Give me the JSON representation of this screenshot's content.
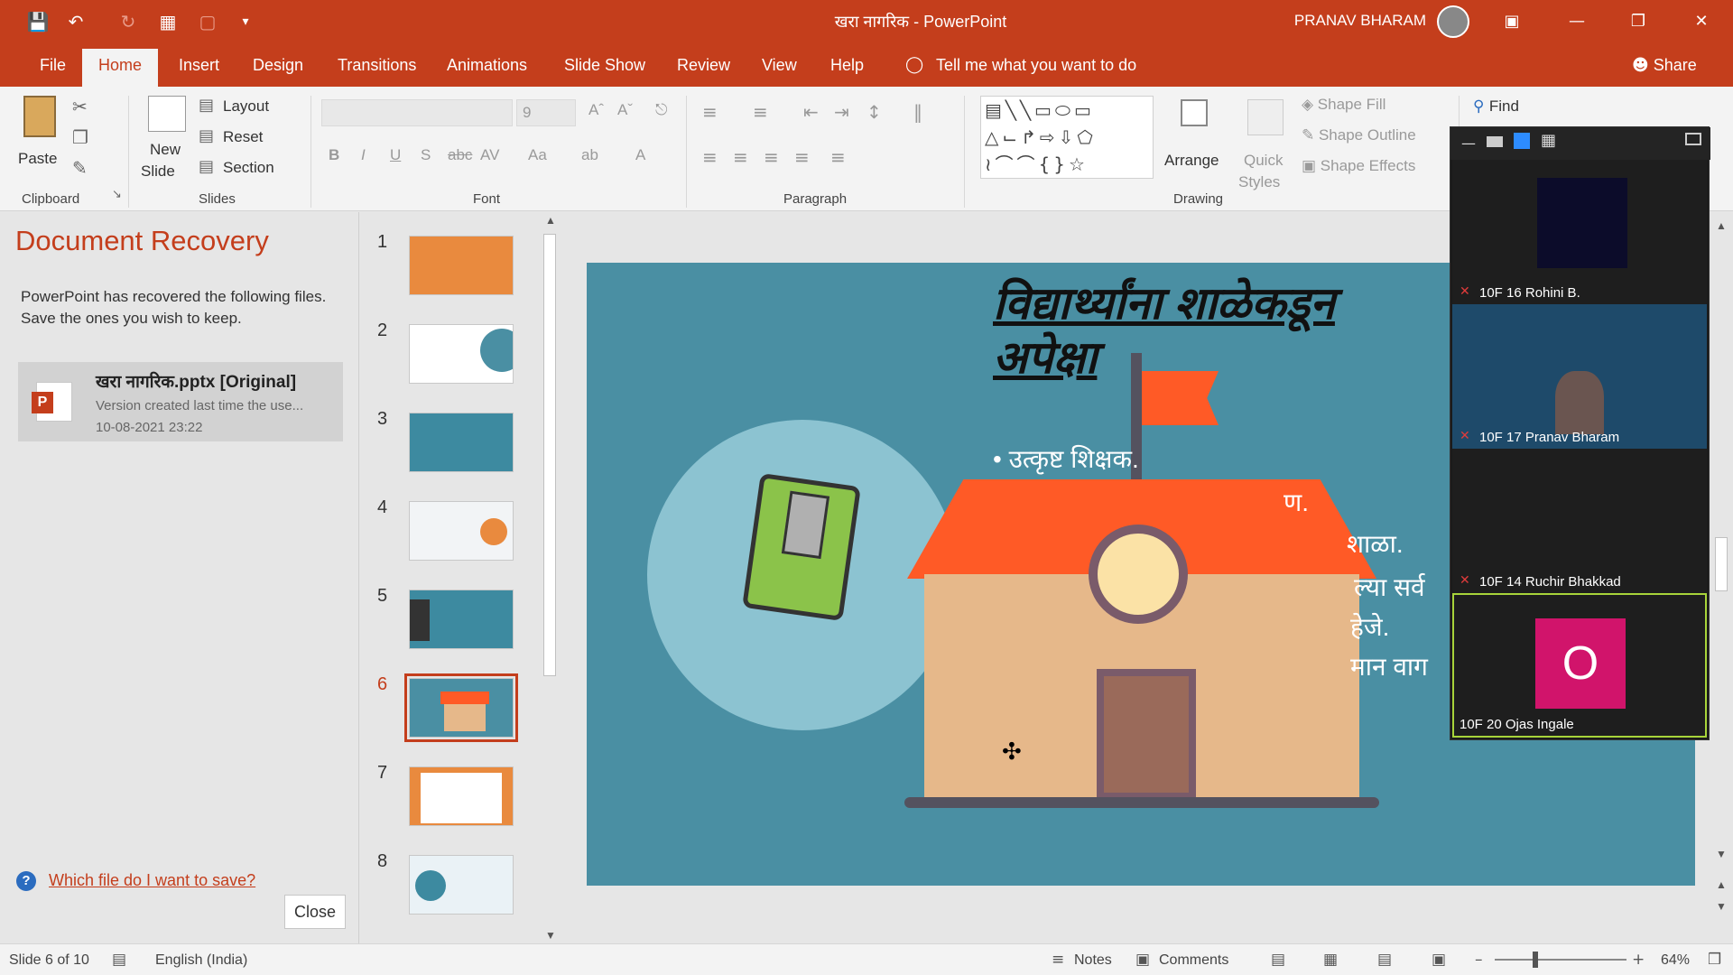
{
  "titlebar": {
    "document_title": "खरा नागरिक",
    "separator": "-",
    "app_name": "PowerPoint",
    "user_name": "PRANAV BHARAM"
  },
  "tabs": [
    "File",
    "Home",
    "Insert",
    "Design",
    "Transitions",
    "Animations",
    "Slide Show",
    "Review",
    "View",
    "Help"
  ],
  "tell_me": "Tell me what you want to do",
  "share": "Share",
  "ribbon": {
    "clipboard": {
      "label": "Clipboard",
      "paste": "Paste"
    },
    "slides": {
      "label": "Slides",
      "new_slide_1": "New",
      "new_slide_2": "Slide",
      "layout": "Layout",
      "reset": "Reset",
      "section": "Section"
    },
    "font": {
      "label": "Font",
      "size": "9"
    },
    "paragraph": {
      "label": "Paragraph"
    },
    "drawing": {
      "label": "Drawing",
      "arrange": "Arrange",
      "quick_1": "Quick",
      "quick_2": "Styles",
      "shape_fill": "Shape Fill",
      "shape_outline": "Shape Outline",
      "shape_effects": "Shape Effects"
    },
    "editing": {
      "find": "Find"
    }
  },
  "recovery": {
    "title": "Document Recovery",
    "description": "PowerPoint has recovered the following files. Save the ones you wish to keep.",
    "file_name": "खरा नागरिक.pptx  [Original]",
    "file_desc": "Version created last time the use...",
    "file_date": "10-08-2021 23:22",
    "help_link": "Which file do I want to save?",
    "close": "Close"
  },
  "thumbnails": [
    "1",
    "2",
    "3",
    "4",
    "5",
    "6",
    "7",
    "8"
  ],
  "selected_slide": 6,
  "slide": {
    "title_line1": "विद्यार्थ्यांना शाळेकडून",
    "title_line2": "अपेक्षा",
    "bullet_1": "• उत्कृष्ट शिक्षक.",
    "bullet_2": "ण.",
    "bullet_3": "शाळा.",
    "bullet_4": "ल्या सर्व",
    "bullet_5": "हेजे.",
    "bullet_6": "मान वाग"
  },
  "zoom": {
    "participants": [
      {
        "name": "10F 16 Rohini B."
      },
      {
        "name": "10F 17 Pranav Bharam"
      },
      {
        "name": "10F 14 Ruchir Bhakkad"
      },
      {
        "name": "10F 20 Ojas Ingale",
        "initial": "O"
      }
    ]
  },
  "status": {
    "slide_info": "Slide 6 of 10",
    "language": "English (India)",
    "notes": "Notes",
    "comments": "Comments",
    "zoom_level": "64%"
  },
  "colors": {
    "accent": "#c43e1c",
    "slide_bg": "#4a8fa3",
    "ojas_tile": "#d1146b"
  }
}
